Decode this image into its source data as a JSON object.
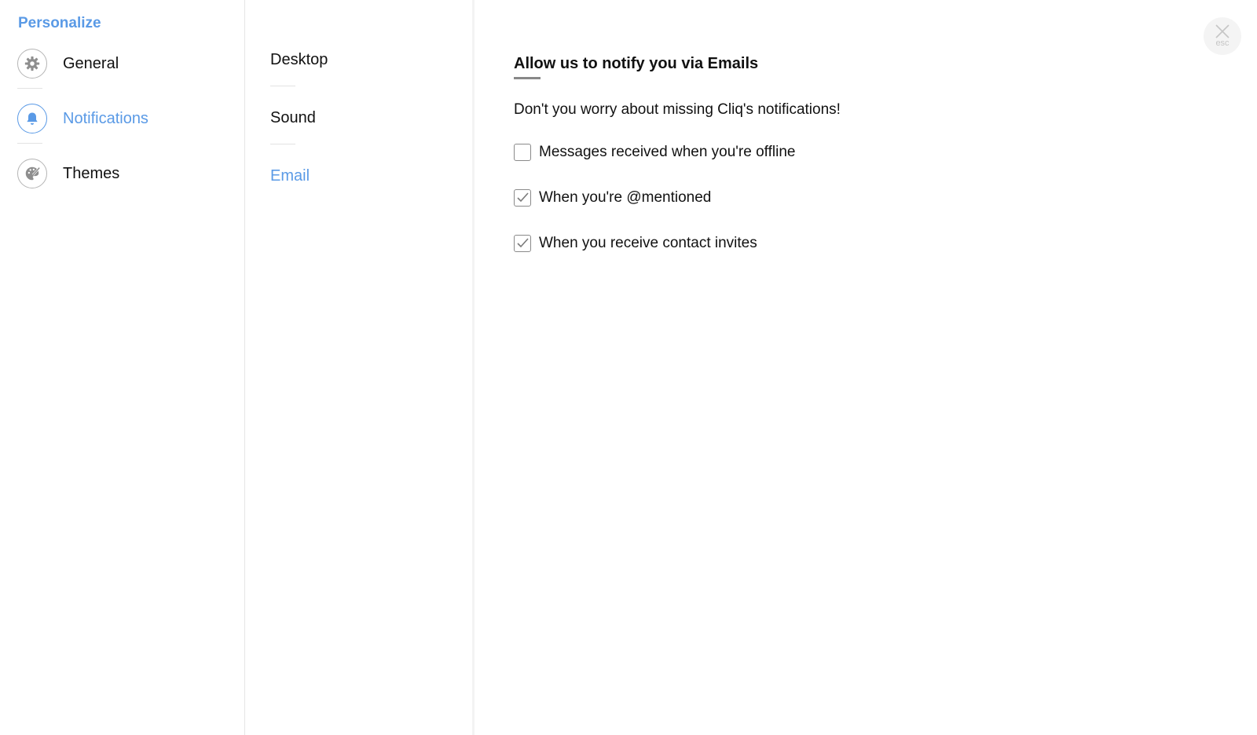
{
  "sidebar": {
    "title": "Personalize",
    "items": [
      {
        "label": "General",
        "icon": "gear-icon",
        "active": false
      },
      {
        "label": "Notifications",
        "icon": "bell-icon",
        "active": true
      },
      {
        "label": "Themes",
        "icon": "palette-icon",
        "active": false
      }
    ]
  },
  "subnav": {
    "items": [
      {
        "label": "Desktop",
        "active": false
      },
      {
        "label": "Sound",
        "active": false
      },
      {
        "label": "Email",
        "active": true
      }
    ]
  },
  "main": {
    "heading": "Allow us to notify you via Emails",
    "description": "Don't you worry about missing Cliq's notifications!",
    "options": [
      {
        "label": "Messages received when you're offline",
        "checked": false
      },
      {
        "label": "When you're @mentioned",
        "checked": true
      },
      {
        "label": "When you receive contact invites",
        "checked": true
      }
    ]
  },
  "close": {
    "label": "esc",
    "icon": "close-icon"
  },
  "colors": {
    "accent": "#5a9ae6",
    "text": "#111111",
    "muted_border": "#b5b5b5"
  }
}
